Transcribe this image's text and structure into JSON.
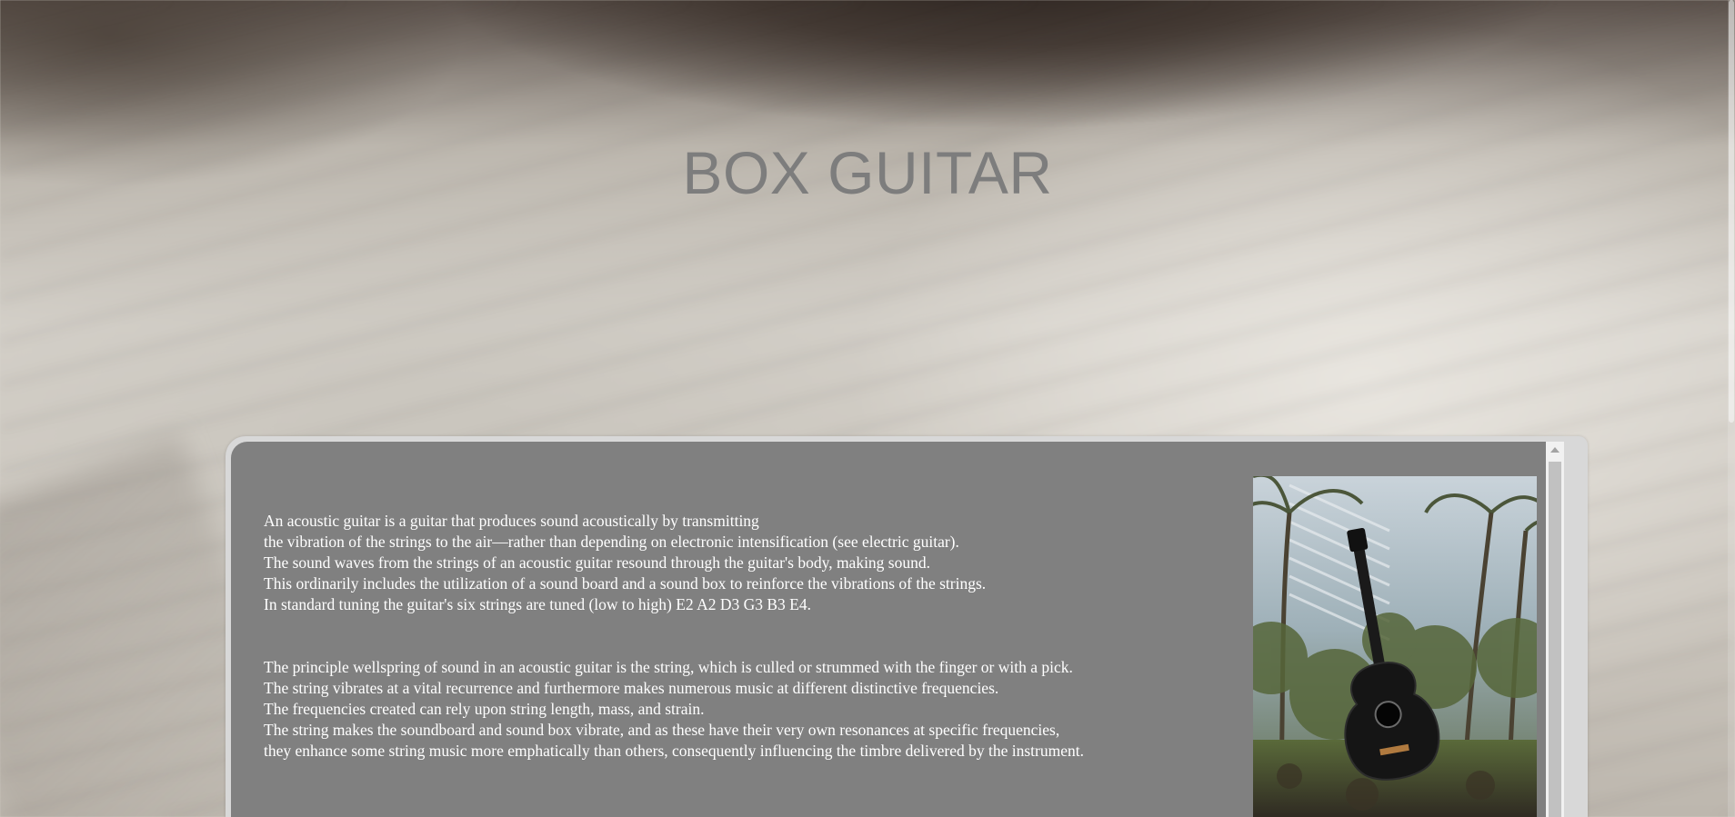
{
  "page": {
    "title": "BOX GUITAR"
  },
  "article": {
    "paragraph1": [
      "An acoustic guitar is a guitar that produces sound acoustically by transmitting",
      "the vibration of the strings to the air—rather than depending on electronic intensification (see electric guitar).",
      "The sound waves from the strings of an acoustic guitar resound through the guitar's body, making sound.",
      "This ordinarily includes the utilization of a sound board and a sound box to reinforce the vibrations of the strings.",
      "In standard tuning the guitar's six strings are tuned (low to high) E2 A2 D3 G3 B3 E4."
    ],
    "paragraph2": [
      "The principle wellspring of sound in an acoustic guitar is the string, which is culled or strummed with the finger or with a pick.",
      "The string vibrates at a vital recurrence and furthermore makes numerous music at different distinctive frequencies.",
      "The frequencies created can rely upon string length, mass, and strain.",
      "The string makes the soundboard and sound box vibrate, and as these have their very own resonances at specific frequencies,",
      "they enhance some string music more emphatically than others, consequently influencing the timbre delivered by the instrument."
    ]
  },
  "image": {
    "icon": "acoustic-guitar-photo"
  },
  "colors": {
    "panel": "#808080",
    "title": "#7d7d7d",
    "text": "#ffffff"
  }
}
